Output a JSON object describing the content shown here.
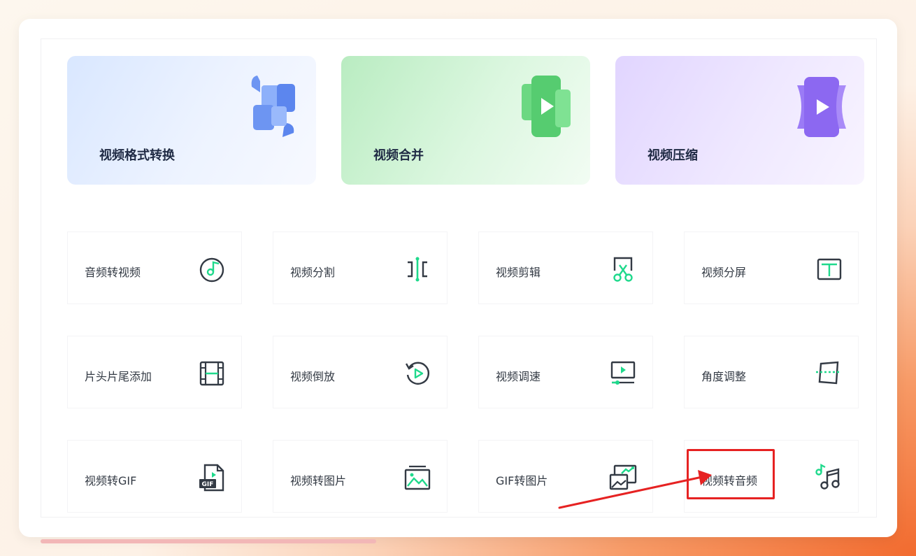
{
  "features": [
    {
      "label": "视频格式转换",
      "icon": "format-convert-icon"
    },
    {
      "label": "视频合并",
      "icon": "merge-icon"
    },
    {
      "label": "视频压缩",
      "icon": "compress-icon"
    }
  ],
  "tools": [
    {
      "label": "音频转视频",
      "icon": "audio-to-video-icon"
    },
    {
      "label": "视频分割",
      "icon": "split-icon"
    },
    {
      "label": "视频剪辑",
      "icon": "scissors-icon"
    },
    {
      "label": "视频分屏",
      "icon": "split-screen-icon"
    },
    {
      "label": "片头片尾添加",
      "icon": "film-strip-icon"
    },
    {
      "label": "视频倒放",
      "icon": "rewind-icon"
    },
    {
      "label": "视频调速",
      "icon": "speed-icon"
    },
    {
      "label": "角度调整",
      "icon": "rotate-icon"
    },
    {
      "label": "视频转GIF",
      "icon": "gif-file-icon"
    },
    {
      "label": "视频转图片",
      "icon": "image-icon"
    },
    {
      "label": "GIF转图片",
      "icon": "gif-to-image-icon"
    },
    {
      "label": "视频转音频",
      "icon": "music-note-icon"
    }
  ],
  "colors": {
    "accent": "#1fd98c",
    "icon_stroke": "#333a44",
    "highlight": "#e62222"
  }
}
